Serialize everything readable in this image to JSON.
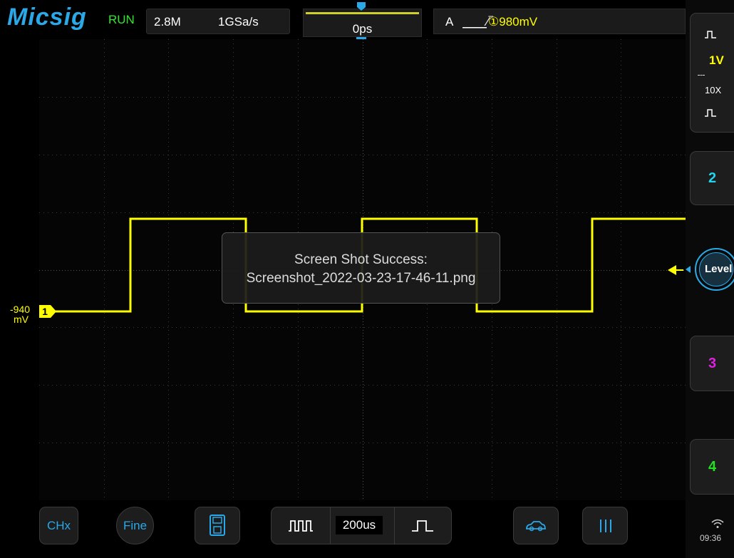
{
  "header": {
    "brand": "Micsig",
    "run_state": "RUN",
    "memory_depth": "2.8M",
    "sample_rate": "1GSa/s",
    "horizontal_position": "0ps",
    "trigger_type": "A",
    "trigger_source": "①980mV"
  },
  "channels": {
    "ch1": {
      "scale": "1V",
      "probe": "10X",
      "color": "#ffff00"
    },
    "ch2": {
      "label": "2",
      "color": "#22d3ee"
    },
    "ch3": {
      "label": "3",
      "color": "#e020e0"
    },
    "ch4": {
      "label": "4",
      "color": "#22e022"
    }
  },
  "offset": {
    "value": "-940",
    "unit": "mV",
    "marker": "1"
  },
  "trigger_level_button": "Level",
  "toast": {
    "line1": "Screen Shot Success:",
    "line2": "Screenshot_2022-03-23-17-46-11.png"
  },
  "bottom": {
    "chx_label": "CHx",
    "fine_label": "Fine",
    "timebase": "200us",
    "icons": [
      "save-icon",
      "timebase-decrease-icon",
      "timebase-increase-icon",
      "auto-icon",
      "menu-icon"
    ]
  },
  "status_bar": {
    "time": "09:36"
  },
  "colors": {
    "accent": "#2aa8e8",
    "waveform": "#ffff00",
    "run": "#2ee82e"
  }
}
